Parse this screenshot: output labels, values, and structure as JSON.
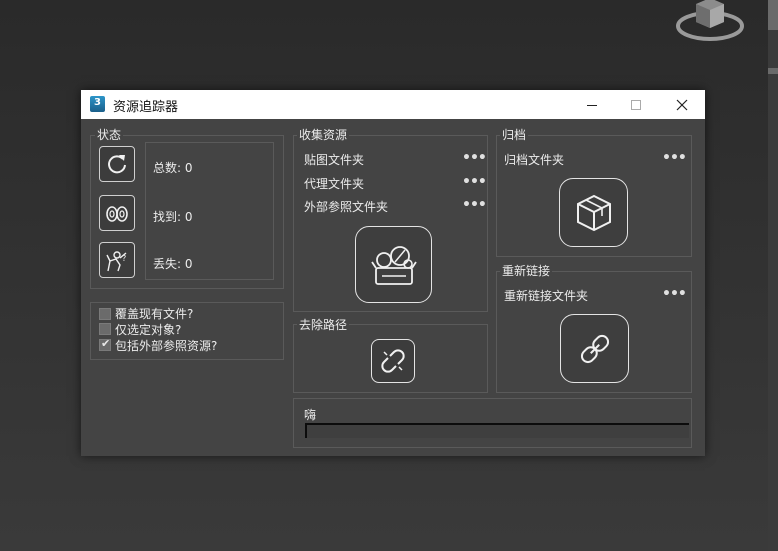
{
  "window": {
    "title": "资源追踪器",
    "app_icon_text": "3"
  },
  "status": {
    "title": "状态",
    "total_label": "总数: 0",
    "found_label": "找到: 0",
    "missing_label": "丢失: 0"
  },
  "options": {
    "overwrite": {
      "label": "覆盖现有文件?",
      "checked": false
    },
    "selected_only": {
      "label": "仅选定对象?",
      "checked": false
    },
    "include_xref": {
      "label": "包括外部参照资源?",
      "checked": true
    }
  },
  "collect": {
    "title": "收集资源",
    "map_folder": "贴图文件夹",
    "proxy_folder": "代理文件夹",
    "xref_folder": "外部参照文件夹",
    "more": "•••"
  },
  "strip_path": {
    "title": "去除路径"
  },
  "archive": {
    "title": "归档",
    "archive_folder": "归档文件夹",
    "more": "•••"
  },
  "relink": {
    "title": "重新链接",
    "relink_folder": "重新链接文件夹",
    "more": "•••"
  },
  "status_bar": {
    "message": "嗨",
    "progress": 0
  },
  "colors": {
    "window_bg": "#444444",
    "group_border": "#5a5a5a",
    "text": "#ececec"
  }
}
